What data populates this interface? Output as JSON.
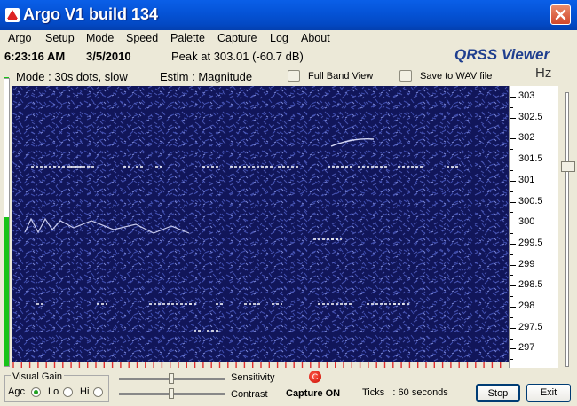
{
  "window": {
    "title": "Argo V1 build 134"
  },
  "menu": [
    "Argo",
    "Setup",
    "Mode",
    "Speed",
    "Palette",
    "Capture",
    "Log",
    "About"
  ],
  "info": {
    "time": "6:23:16 AM",
    "date": "3/5/2010",
    "peak": "Peak at  303.01  (-60.7 dB)",
    "logo": "QRSS Viewer"
  },
  "mode": {
    "mode": "Mode : 30s dots, slow",
    "estim": "Estim : Magnitude",
    "full_band": "Full Band View",
    "save_wav": "Save to WAV file"
  },
  "scale": {
    "unit": "Hz",
    "labels": [
      "303",
      "302.5",
      "302",
      "301.5",
      "301",
      "300.5",
      "300",
      "299.5",
      "299",
      "298.5",
      "298",
      "297.5",
      "297"
    ]
  },
  "bottom": {
    "visual_gain": "Visual Gain",
    "agc": "Agc",
    "lo": "Lo",
    "hi": "Hi",
    "sensitivity": "Sensitivity",
    "contrast": "Contrast",
    "capture": "Capture ON",
    "capture_icon": "C",
    "ticks": "Ticks   : 60 seconds",
    "stop": "Stop",
    "exit": "Exit"
  },
  "colors": {
    "titlebar": "#0554D8",
    "waterfall": "#11165A",
    "trace": "#FFFFFF",
    "level": "#19C419",
    "tick_marks": "#E03030"
  },
  "level_meter": 0.52
}
